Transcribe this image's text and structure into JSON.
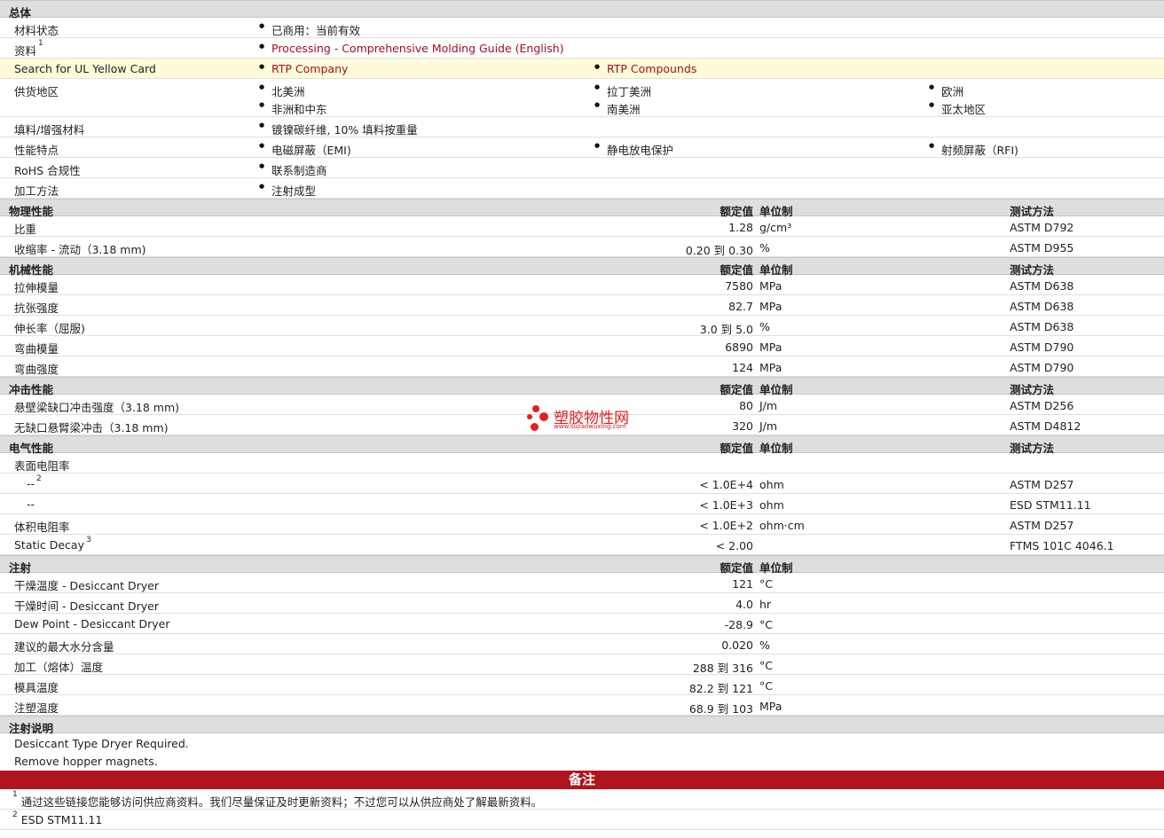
{
  "general": {
    "title": "总体",
    "status_label": "材料状态",
    "status_value": "已商用：当前有效",
    "docs_label": "资料",
    "docs_sup": "1",
    "docs_link": "Processing - Comprehensive Molding Guide (English)",
    "ul_label": "Search for UL Yellow Card",
    "ul_link1": "RTP Company",
    "ul_link2": "RTP Compounds",
    "region_label": "供货地区",
    "regions": [
      "北美洲",
      "拉丁美洲",
      "欧洲",
      "非洲和中东",
      "南美洲",
      "亚太地区"
    ],
    "filler_label": "填料/增强材料",
    "filler_value": "镀镍碳纤维, 10% 填料按重量",
    "features_label": "性能特点",
    "features": [
      "电磁屏蔽（EMI)",
      "静电放电保护",
      "射频屏蔽（RFI)"
    ],
    "rohs_label": "RoHS 合规性",
    "rohs_value": "联系制造商",
    "process_label": "加工方法",
    "process_value": "注射成型"
  },
  "headers": {
    "rated": "额定值",
    "unit": "单位制",
    "method": "测试方法"
  },
  "sections": {
    "physical": "物理性能",
    "mechanical": "机械性能",
    "impact": "冲击性能",
    "electrical": "电气性能",
    "injection": "注射",
    "injection_notes": "注射说明"
  },
  "physical_rows": [
    {
      "label": "比重",
      "value": "1.28",
      "unit": "g/cm³",
      "method": "ASTM D792"
    },
    {
      "label": "收缩率  - 流动（3.18 mm)",
      "value": "0.20 到  0.30",
      "unit": "%",
      "method": "ASTM D955"
    }
  ],
  "mechanical_rows": [
    {
      "label": "拉伸模量",
      "value": "7580",
      "unit": "MPa",
      "method": "ASTM D638"
    },
    {
      "label": "抗张强度",
      "value": "82.7",
      "unit": "MPa",
      "method": "ASTM D638"
    },
    {
      "label": "伸长率（屈服)",
      "value": "3.0 到  5.0",
      "unit": "%",
      "method": "ASTM D638"
    },
    {
      "label": "弯曲模量",
      "value": "6890",
      "unit": "MPa",
      "method": "ASTM D790"
    },
    {
      "label": "弯曲强度",
      "value": "124",
      "unit": "MPa",
      "method": "ASTM D790"
    }
  ],
  "impact_rows": [
    {
      "label": "悬壁梁缺口冲击强度（3.18 mm)",
      "value": "80",
      "unit": "J/m",
      "method": "ASTM D256"
    },
    {
      "label": "无缺口悬臂梁冲击（3.18 mm)",
      "value": "320",
      "unit": "J/m",
      "method": "ASTM D4812"
    }
  ],
  "electrical_rows": [
    {
      "label": "表面电阻率",
      "value": "",
      "unit": "",
      "method": ""
    },
    {
      "label": "--",
      "sup": "2",
      "value": "< 1.0E+4",
      "unit": "ohm",
      "method": "ASTM D257",
      "indent": true
    },
    {
      "label": "--",
      "value": "< 1.0E+3",
      "unit": "ohm",
      "method": "ESD STM11.11",
      "indent": true
    },
    {
      "label": "体积电阻率",
      "value": "< 1.0E+2",
      "unit": "ohm·cm",
      "method": "ASTM D257"
    },
    {
      "label": "Static Decay",
      "sup": "3",
      "value": "< 2.00",
      "unit": "",
      "method": "FTMS 101C 4046.1"
    }
  ],
  "injection_rows": [
    {
      "label": "干燥温度  - Desiccant Dryer",
      "value": "121",
      "unit": "°C"
    },
    {
      "label": "干燥时间  - Desiccant Dryer",
      "value": "4.0",
      "unit": "hr"
    },
    {
      "label": "Dew Point - Desiccant Dryer",
      "value": "-28.9",
      "unit": "°C"
    },
    {
      "label": "建议的最大水分含量",
      "value": "0.020",
      "unit": "%"
    },
    {
      "label": "加工（熔体）温度",
      "value": "288 到  316",
      "unit": "°C"
    },
    {
      "label": "模具温度",
      "value": "82.2 到  121",
      "unit": "°C"
    },
    {
      "label": "注塑温度",
      "value": "68.9 到  103",
      "unit": "MPa"
    }
  ],
  "injection_notes": [
    "Desiccant Type Dryer Required.",
    "Remove hopper magnets."
  ],
  "notes_title": "备注",
  "footnotes": [
    {
      "num": "1",
      "text": "通过这些链接您能够访问供应商资料。我们尽量保证及时更新资料；不过您可以从供应商处了解最新资料。"
    },
    {
      "num": "2",
      "text": "ESD STM11.11"
    }
  ],
  "watermark": {
    "name": "塑胶物性网",
    "url": "www.sujiaowuxing.com"
  }
}
